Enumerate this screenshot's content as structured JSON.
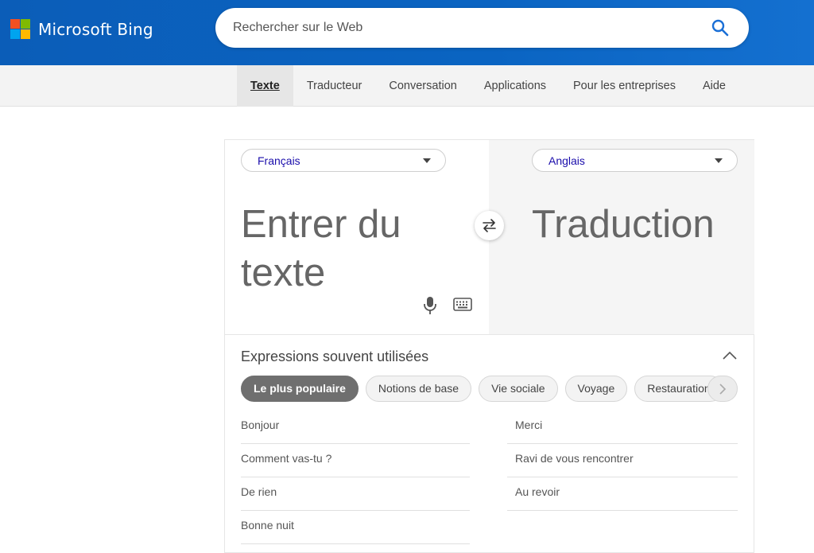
{
  "header": {
    "brand": "Microsoft Bing",
    "search_placeholder": "Rechercher sur le Web"
  },
  "nav": {
    "tabs": [
      {
        "label": "Texte",
        "active": true
      },
      {
        "label": "Traducteur",
        "active": false
      },
      {
        "label": "Conversation",
        "active": false
      },
      {
        "label": "Applications",
        "active": false
      },
      {
        "label": "Pour les entreprises",
        "active": false
      },
      {
        "label": "Aide",
        "active": false
      }
    ]
  },
  "translator": {
    "source_language": "Français",
    "target_language": "Anglais",
    "input_placeholder": "Entrer du texte",
    "output_placeholder": "Traduction"
  },
  "phrases": {
    "title": "Expressions souvent utilisées",
    "categories": [
      {
        "label": "Le plus populaire",
        "active": true
      },
      {
        "label": "Notions de base",
        "active": false
      },
      {
        "label": "Vie sociale",
        "active": false
      },
      {
        "label": "Voyage",
        "active": false
      },
      {
        "label": "Restauration",
        "active": false
      }
    ],
    "left": [
      "Bonjour",
      "Comment vas-tu ?",
      "De rien",
      "Bonne nuit"
    ],
    "right": [
      "Merci",
      "Ravi de vous rencontrer",
      "Au revoir"
    ]
  },
  "colors": {
    "header_blue": "#0b5db8",
    "link_blue": "#1a0dab",
    "active_chip": "#6f6f6f"
  },
  "icons": [
    "microsoft-logo",
    "search-icon",
    "chevron-down-icon",
    "swap-icon",
    "microphone-icon",
    "keyboard-icon",
    "chevron-up-icon",
    "chevron-right-icon"
  ]
}
